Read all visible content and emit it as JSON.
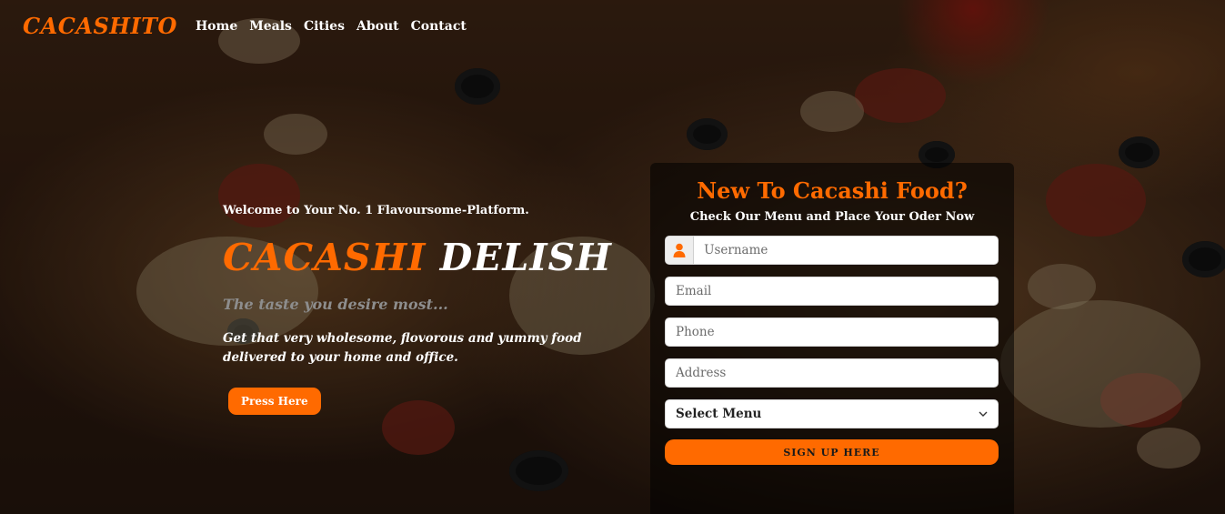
{
  "nav": {
    "brand": "CACASHITO",
    "links": [
      "Home",
      "Meals",
      "Cities",
      "About",
      "Contact"
    ]
  },
  "hero": {
    "welcome": "Welcome to Your No. 1 Flavoursome-Platform.",
    "headline_part1": "CACASHI",
    "headline_part2": "DELISH",
    "tagline": "The taste you desire most...",
    "description": "Get that very wholesome, flovorous and yummy food delivered to your home and office.",
    "cta_label": "Press Here"
  },
  "form": {
    "title": "New To Cacashi Food?",
    "subtitle": "Check Our Menu and Place Your Oder Now",
    "username_placeholder": "Username",
    "email_placeholder": "Email",
    "phone_placeholder": "Phone",
    "address_placeholder": "Address",
    "select_value": "Select Menu",
    "submit_label": "SIGN UP HERE"
  },
  "colors": {
    "accent": "#ff6a00",
    "text_light": "#ffffff",
    "tagline_gray": "#8d8d8d"
  },
  "icons": {
    "username": "user-icon",
    "select": "chevron-down-icon"
  }
}
